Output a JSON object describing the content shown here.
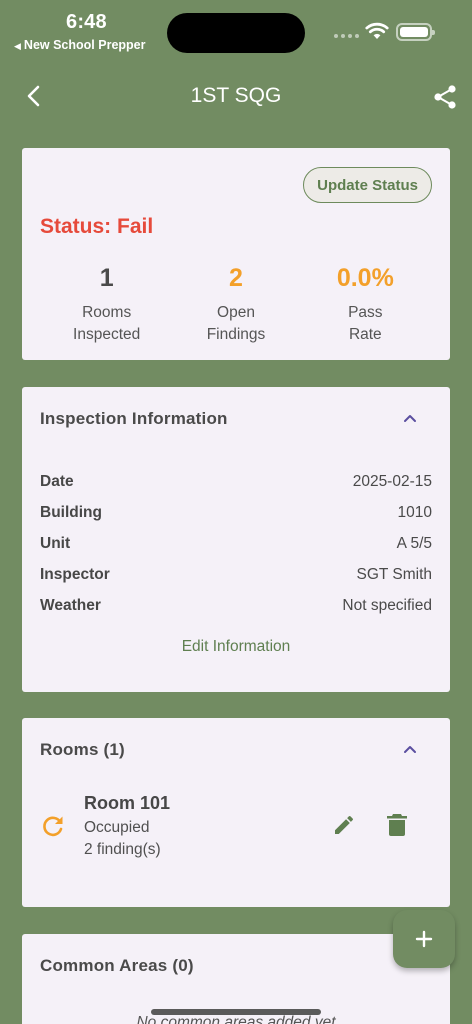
{
  "status_bar": {
    "time": "6:48",
    "back_app": "New School Prepper"
  },
  "header": {
    "title": "1ST SQG"
  },
  "summary": {
    "update_button": "Update Status",
    "status_text": "Status: Fail",
    "status_color": "#e64a3b",
    "stats": [
      {
        "value": "1",
        "label_line1": "Rooms",
        "label_line2": "Inspected"
      },
      {
        "value": "2",
        "label_line1": "Open",
        "label_line2": "Findings"
      },
      {
        "value": "0.0%",
        "label_line1": "Pass",
        "label_line2": "Rate"
      }
    ]
  },
  "inspection_info": {
    "heading": "Inspection Information",
    "rows": [
      {
        "key": "Date",
        "value": "2025-02-15"
      },
      {
        "key": "Building",
        "value": "1010"
      },
      {
        "key": "Unit",
        "value": "A 5/5"
      },
      {
        "key": "Inspector",
        "value": "SGT Smith"
      },
      {
        "key": "Weather",
        "value": "Not specified"
      }
    ],
    "edit_link": "Edit Information"
  },
  "rooms": {
    "heading": "Rooms (1)",
    "items": [
      {
        "name": "Room 101",
        "occupancy": "Occupied",
        "findings": "2 finding(s)"
      }
    ]
  },
  "common_areas": {
    "heading": "Common Areas (0)",
    "empty_text": "No common areas added yet"
  },
  "colors": {
    "background": "#728c62",
    "accent": "#5f7f50",
    "warning": "#f3a02a",
    "fail": "#e64a3b",
    "card": "#f5f1f8"
  },
  "icons": [
    "back-arrow-icon",
    "share-icon",
    "chevron-up-icon",
    "refresh-icon",
    "pencil-icon",
    "trash-icon",
    "plus-icon"
  ]
}
